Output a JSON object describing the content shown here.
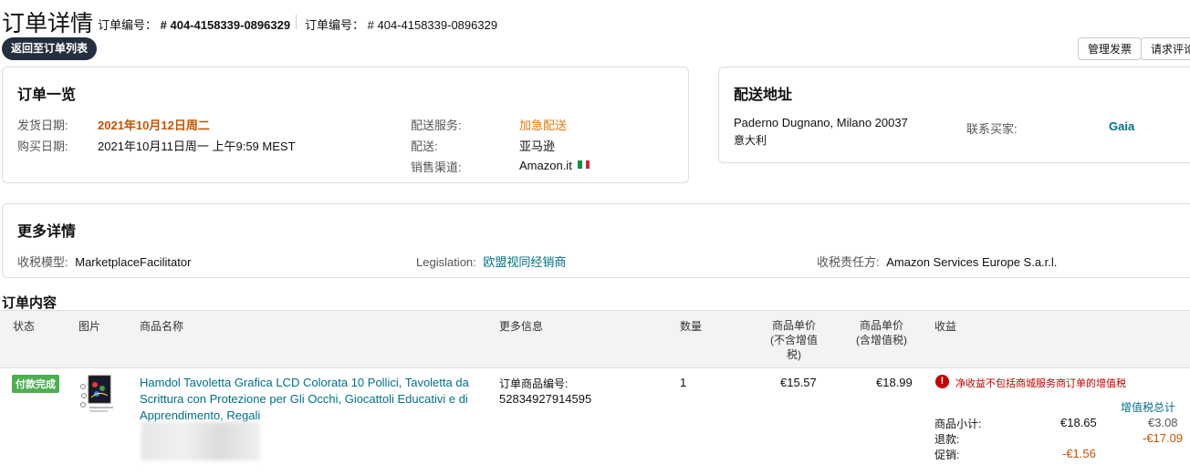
{
  "header": {
    "title": "订单详情",
    "order_label": "订单编号：",
    "order_number_bold": "# 404-4158339-0896329",
    "order_label_2": "订单编号：",
    "order_number_2": "# 404-4158339-0896329",
    "back_button": "返回至订单列表",
    "manage_invoice": "管理发票",
    "request_review": "请求评论"
  },
  "summary": {
    "title": "订单一览",
    "ship_date_label": "发货日期:",
    "ship_date": "2021年10月12日周二",
    "purchase_date_label": "购买日期:",
    "purchase_date": "2021年10月11日周一 上午9:59 MEST",
    "ship_service_label": "配送服务:",
    "ship_service": "加急配送",
    "fulfillment_label": "配送:",
    "fulfillment": "亚马逊",
    "channel_label": "销售渠道:",
    "channel": "Amazon.it"
  },
  "address": {
    "title": "配送地址",
    "line1": "Paderno Dugnano, Milano 20037",
    "line2": "意大利",
    "contact_label": "联系买家:",
    "contact_name": "Gaia"
  },
  "more": {
    "title": "更多详情",
    "tax_model_label": "收税模型:",
    "tax_model": "MarketplaceFacilitator",
    "legislation_label": "Legislation:",
    "legislation": "欧盟视同经销商",
    "tax_resp_label": "收税责任方:",
    "tax_resp": "Amazon Services Europe S.a.r.l."
  },
  "contents": {
    "title": "订单内容",
    "columns": {
      "status": "状态",
      "image": "图片",
      "name": "商品名称",
      "more_info": "更多信息",
      "qty": "数量",
      "price_ex_l1": "商品单价",
      "price_ex_l2": "(不含增值",
      "price_ex_l3": "税)",
      "price_inc_l1": "商品单价",
      "price_inc_l2": "(含增值税)",
      "revenue": "收益"
    },
    "row": {
      "status": "付款完成",
      "name": "Hamdol Tavoletta Grafica LCD Colorata 10 Pollici, Tavoletta da Scrittura con Protezione per Gli Occhi, Giocattoli Educativi e di Apprendimento, Regali",
      "item_no_label": "订单商品编号:",
      "item_no": "52834927914595",
      "qty": "1",
      "price_ex": "€15.57",
      "price_inc": "€18.99",
      "warning": "净收益不包括商城服务商订单的增值税",
      "vat_total_label": "增值税总计",
      "subtotal_label": "商品小计:",
      "subtotal": "€18.65",
      "subtotal_vat": "€3.08",
      "refund_label": "退款:",
      "refund_vat": "-€17.09",
      "promo_label": "促销:",
      "promo": "-€1.56"
    }
  },
  "colors": {
    "accent_orange": "#c45500",
    "link_teal": "#007185",
    "badge_green": "#4caf50",
    "warn_red": "#c40000",
    "back_button_bg": "#232f3e"
  }
}
